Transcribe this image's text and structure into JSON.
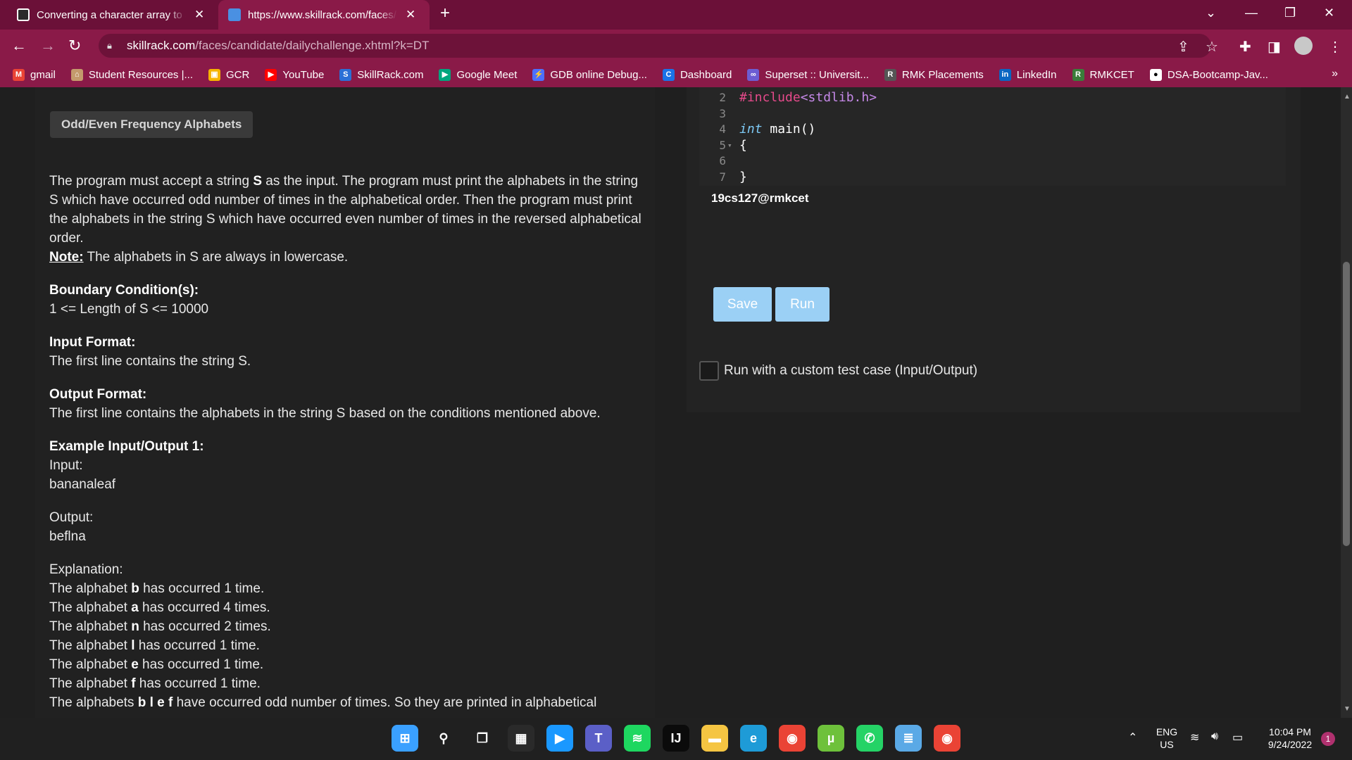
{
  "tabs": [
    {
      "title": "Converting a character array to a",
      "active": false
    },
    {
      "title": "https://www.skillrack.com/faces/c",
      "active": true
    }
  ],
  "window_controls": {
    "dropdown": "⌄",
    "minimize": "—",
    "restore": "❐",
    "close": "✕"
  },
  "address": {
    "host": "skillrack.com",
    "path": "/faces/candidate/dailychallenge.xhtml?k=DT"
  },
  "bookmarks": [
    {
      "label": "gmail",
      "icon": "gmail-icon",
      "color": "#ea4335",
      "glyph": "M"
    },
    {
      "label": "Student Resources |...",
      "icon": "school-icon",
      "color": "#c49a6c",
      "glyph": "⌂"
    },
    {
      "label": "GCR",
      "icon": "google-classroom-icon",
      "color": "#f6b400",
      "glyph": "▣"
    },
    {
      "label": "YouTube",
      "icon": "youtube-icon",
      "color": "#ff0000",
      "glyph": "▶"
    },
    {
      "label": "SkillRack.com",
      "icon": "skillrack-icon",
      "color": "#2b6fd6",
      "glyph": "S"
    },
    {
      "label": "Google Meet",
      "icon": "google-meet-icon",
      "color": "#00a67e",
      "glyph": "▶"
    },
    {
      "label": "GDB online Debug...",
      "icon": "gdb-icon",
      "color": "#4c6fff",
      "glyph": "⚡"
    },
    {
      "label": "Dashboard",
      "icon": "dashboard-icon",
      "color": "#1a73e8",
      "glyph": "C"
    },
    {
      "label": "Superset :: Universit...",
      "icon": "superset-icon",
      "color": "#6c5dd3",
      "glyph": "∞"
    },
    {
      "label": "RMK Placements",
      "icon": "rmk-icon",
      "color": "#555555",
      "glyph": "R"
    },
    {
      "label": "LinkedIn",
      "icon": "linkedin-icon",
      "color": "#0a66c2",
      "glyph": "in"
    },
    {
      "label": "RMKCET",
      "icon": "rmkcet-icon",
      "color": "#3a7d3a",
      "glyph": "R"
    },
    {
      "label": "DSA-Bootcamp-Jav...",
      "icon": "github-icon",
      "color": "#ffffff",
      "glyph": "●"
    }
  ],
  "bookmarks_more": "»",
  "problem": {
    "title": "Odd/Even Frequency Alphabets",
    "p1_a": "The program must accept a string ",
    "p1_b": "S",
    "p1_c": " as the input. The program must print the alphabets in the string S which have occurred odd number of times in the alphabetical order. Then the program must print the alphabets in the string S which have occurred even number of times in the reversed alphabetical order.",
    "note_label": "Note:",
    "note_text": " The alphabets in S are always in lowercase.",
    "boundary_label": "Boundary Condition(s):",
    "boundary_text": "1 <= Length of S <= 10000",
    "input_label": "Input Format:",
    "input_text": "The first line contains the string S.",
    "output_label": "Output Format:",
    "output_text": "The first line contains the alphabets in the string S based on the conditions mentioned above.",
    "example_label": "Example Input/Output 1:",
    "input_word": "Input:",
    "input_value": "bananaleaf",
    "output_word": "Output:",
    "output_value": "beflna",
    "explanation_word": "Explanation:",
    "explanations": [
      {
        "pre": "The alphabet ",
        "b": "b",
        "post": " has occurred 1 time."
      },
      {
        "pre": "The alphabet ",
        "b": "a",
        "post": " has occurred 4 times."
      },
      {
        "pre": "The alphabet ",
        "b": "n",
        "post": " has occurred 2 times."
      },
      {
        "pre": "The alphabet ",
        "b": "l",
        "post": " has occurred 1 time."
      },
      {
        "pre": "The alphabet ",
        "b": "e",
        "post": " has occurred 1 time."
      },
      {
        "pre": "The alphabet ",
        "b": "f",
        "post": " has occurred 1 time."
      },
      {
        "pre": "The alphabets ",
        "b": "b l e f",
        "post": " have occurred odd number of times. So they are printed in alphabetical"
      }
    ]
  },
  "editor": {
    "lines": [
      {
        "num": "2",
        "tokens": [
          {
            "t": "#include",
            "c": "pp"
          },
          {
            "t": "<stdlib.h>",
            "c": "hd"
          }
        ]
      },
      {
        "num": "3",
        "tokens": []
      },
      {
        "num": "4",
        "tokens": [
          {
            "t": "int",
            "c": "kw"
          },
          {
            "t": " main()",
            "c": "fn"
          }
        ]
      },
      {
        "num": "5",
        "fold": "▾",
        "tokens": [
          {
            "t": "{",
            "c": "fn"
          }
        ]
      },
      {
        "num": "6",
        "tokens": []
      },
      {
        "num": "7",
        "tokens": [
          {
            "t": "}",
            "c": "fn"
          }
        ]
      }
    ],
    "user": "19cs127@rmkcet"
  },
  "actions": {
    "save": "Save",
    "run": "Run",
    "custom_test": "Run with a custom test case (Input/Output)"
  },
  "taskbar": {
    "apps": [
      {
        "name": "windows-start-icon",
        "color": "#3aa0ff",
        "glyph": "⊞"
      },
      {
        "name": "search-icon",
        "color": "transparent",
        "glyph": "⚲"
      },
      {
        "name": "task-view-icon",
        "color": "transparent",
        "glyph": "❐"
      },
      {
        "name": "microsoft-store-icon",
        "color": "#2a2a2a",
        "glyph": "▦"
      },
      {
        "name": "prime-video-icon",
        "color": "#1a98ff",
        "glyph": "▶"
      },
      {
        "name": "teams-icon",
        "color": "#5b5fc7",
        "glyph": "T"
      },
      {
        "name": "spotify-icon",
        "color": "#1ed760",
        "glyph": "≋"
      },
      {
        "name": "intellij-icon",
        "color": "#0b0b0b",
        "glyph": "IJ"
      },
      {
        "name": "file-explorer-icon",
        "color": "#f5c542",
        "glyph": "▬"
      },
      {
        "name": "edge-icon",
        "color": "#1e9bd7",
        "glyph": "e"
      },
      {
        "name": "chrome-icon",
        "color": "#ea4335",
        "glyph": "◉"
      },
      {
        "name": "utorrent-icon",
        "color": "#6ec13b",
        "glyph": "µ"
      },
      {
        "name": "whatsapp-icon",
        "color": "#25d366",
        "glyph": "✆"
      },
      {
        "name": "notepad-icon",
        "color": "#5aa9e6",
        "glyph": "≣"
      },
      {
        "name": "chrome-profile-icon",
        "color": "#ea4335",
        "glyph": "◉"
      }
    ],
    "lang": "ENG",
    "region": "US",
    "time": "10:04 PM",
    "date": "9/24/2022",
    "notification_count": "1"
  }
}
